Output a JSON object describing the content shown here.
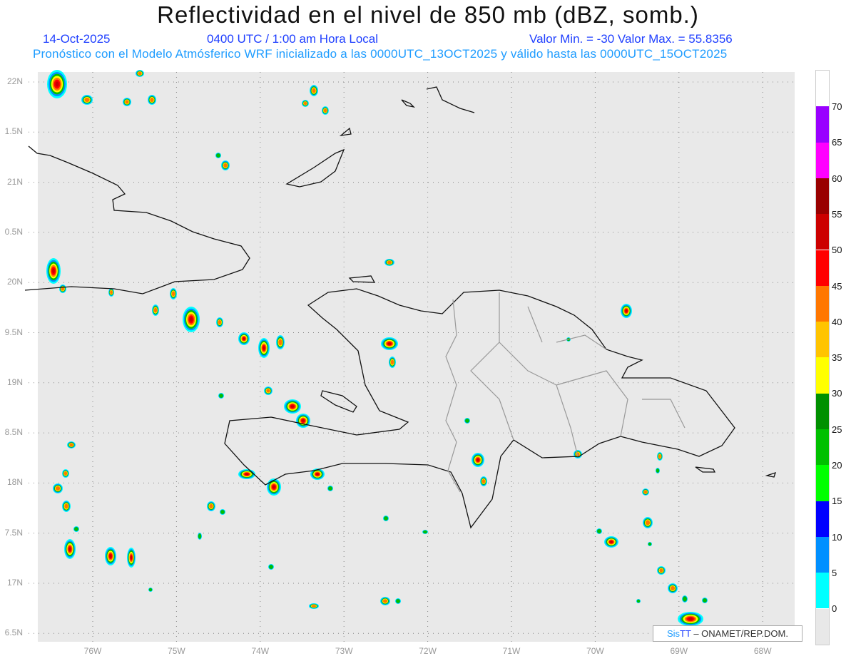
{
  "header": {
    "title": "Reflectividad en el nivel de 850 mb (dBZ, somb.)",
    "date": "14-Oct-2025",
    "time": "0400 UTC / 1:00 am Hora Local",
    "minmax": "Valor Min. = -30  Valor Max. = 55.8356",
    "subtitle": "Pronóstico con el Modelo Atmósferico WRF inicializado a las 0000UTC_13OCT2025 y válido hasta las  0000UTC_15OCT2025"
  },
  "axes": {
    "y_labels": [
      "22N",
      "1.5N",
      "21N",
      "0.5N",
      "20N",
      "9.5N",
      "19N",
      "8.5N",
      "18N",
      "7.5N",
      "17N",
      "6.5N"
    ],
    "x_labels": [
      "76W",
      "75W",
      "74W",
      "73W",
      "72W",
      "71W",
      "70W",
      "69W",
      "68W"
    ]
  },
  "colorbar": {
    "labels": [
      "70",
      "65",
      "60",
      "55",
      "50",
      "45",
      "40",
      "35",
      "30",
      "25",
      "20",
      "15",
      "10",
      "5",
      "0"
    ],
    "colors": [
      "#ffffff",
      "#9900ff",
      "#ff00ff",
      "#990000",
      "#cc0000",
      "#ff0000",
      "#ff7700",
      "#ffc400",
      "#ffff00",
      "#009000",
      "#00c000",
      "#00ff00",
      "#0000ff",
      "#0090ff",
      "#00ffff",
      "#e8e8e8"
    ]
  },
  "logo": {
    "sis": "Sis",
    "pi": "TT",
    "rest": " – ONAMET/REP.DOM."
  }
}
